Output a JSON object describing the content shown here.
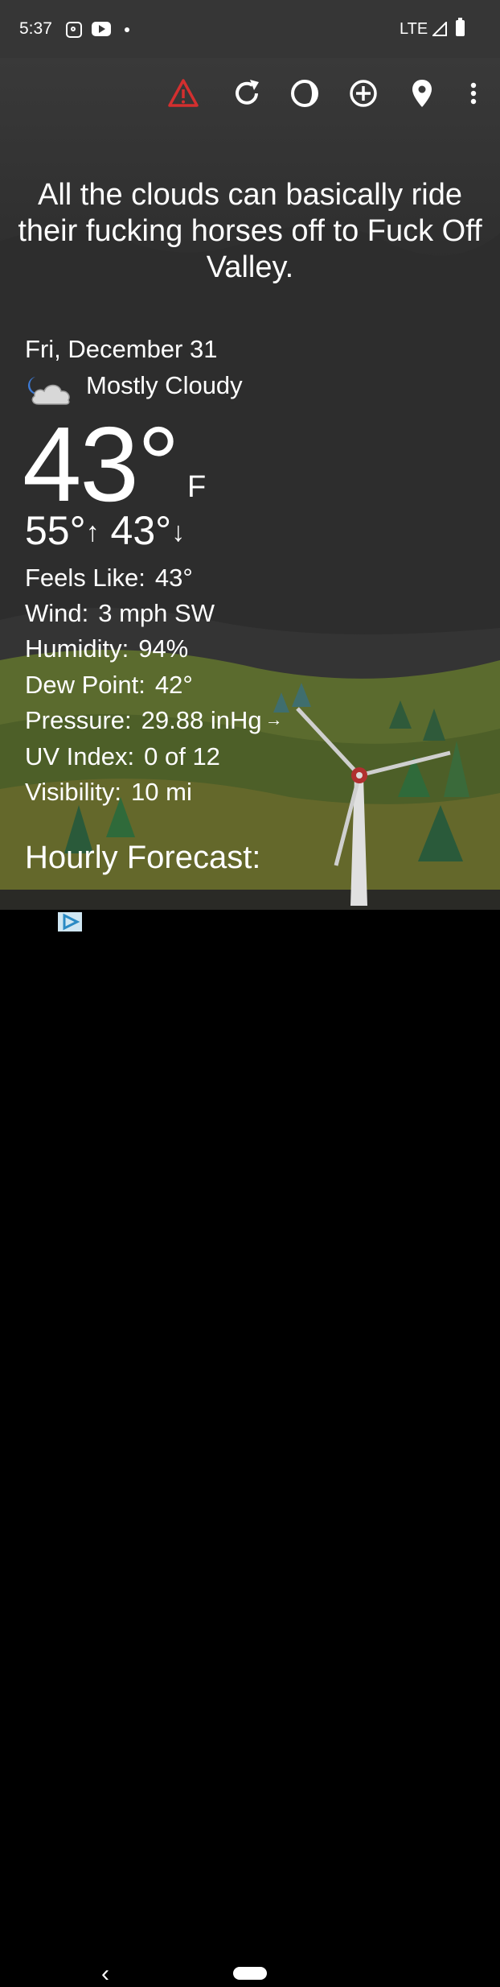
{
  "status_bar": {
    "time": "5:37",
    "network": "LTE",
    "icons": [
      "instagram-icon",
      "youtube-icon",
      "notification-dot-icon",
      "signal-icon",
      "battery-icon"
    ]
  },
  "toolbar": {
    "icons": [
      "alert-icon",
      "refresh-icon",
      "theme-icon",
      "add-location-icon",
      "location-pin-icon",
      "more-vert-icon"
    ],
    "alert_color": "#d32f2f"
  },
  "quote": "All the clouds can basically ride their fucking horses off to Fuck Off Valley.",
  "current": {
    "date": "Fri, December 31",
    "condition": "Mostly Cloudy",
    "condition_icon": "moon-cloud-icon",
    "temperature": "43°",
    "unit": "F",
    "high": "55°",
    "low": "43°",
    "high_arrow": "↑",
    "low_arrow": "↓"
  },
  "details": {
    "feels_like_label": "Feels Like:",
    "feels_like": "43°",
    "wind_label": "Wind:",
    "wind": "3 mph SW",
    "humidity_label": "Humidity:",
    "humidity": "94%",
    "dew_point_label": "Dew Point:",
    "dew_point": "42°",
    "pressure_label": "Pressure:",
    "pressure": "29.88 inHg",
    "pressure_trend": "→",
    "uv_label": "UV Index:",
    "uv": "0 of 12",
    "visibility_label": "Visibility:",
    "visibility": "10 mi"
  },
  "hourly_title": "Hourly Forecast:",
  "navigation": {
    "back": "‹"
  }
}
